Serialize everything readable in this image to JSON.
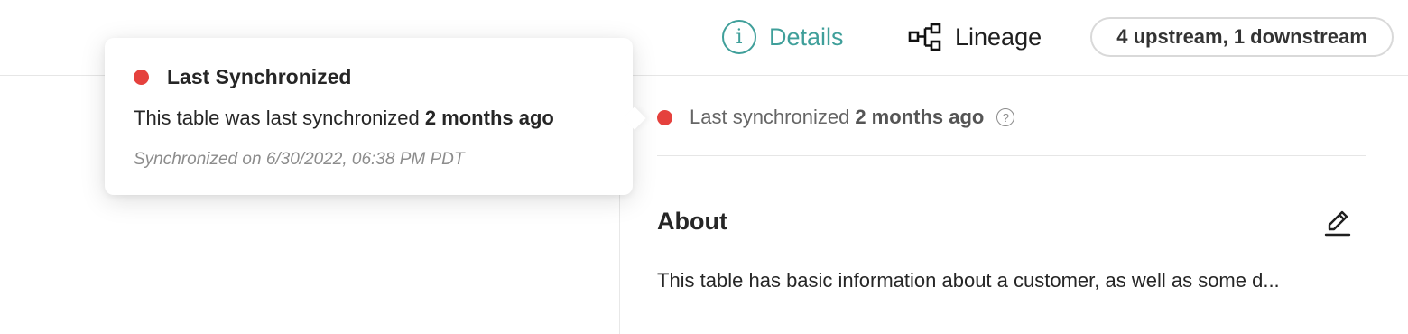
{
  "header": {
    "tabs": [
      {
        "label": "Details",
        "icon": "info-circle-icon",
        "active": true
      },
      {
        "label": "Lineage",
        "icon": "lineage-graph-icon",
        "active": false
      }
    ],
    "lineage_pill": "4 upstream, 1 downstream"
  },
  "panel": {
    "sync": {
      "label": "Last synchronized",
      "value": "2 months ago",
      "status_color": "#e5413d",
      "help_icon": "question-circle-icon"
    },
    "about": {
      "title": "About",
      "edit_icon": "pencil-icon",
      "description": "This table has basic information about a customer, as well as some d..."
    }
  },
  "tooltip": {
    "title": "Last Synchronized",
    "body_prefix": "This table was last synchronized",
    "body_value": "2 months ago",
    "meta": "Synchronized on 6/30/2022, 06:38 PM PDT"
  },
  "colors": {
    "accent": "#3f9f9a",
    "status_red": "#e5413d"
  }
}
